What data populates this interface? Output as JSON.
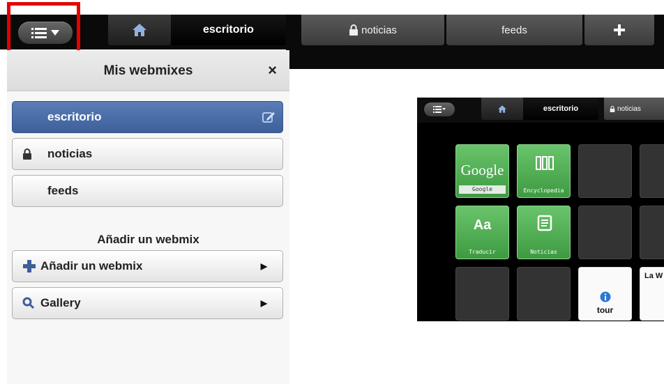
{
  "tabs": {
    "home_icon": "home-icon",
    "active": "escritorio",
    "noticias": "noticias",
    "feeds": "feeds",
    "add_icon": "plus-icon"
  },
  "menu": {
    "list_icon": "list-icon",
    "caret_icon": "caret-down-icon"
  },
  "panel": {
    "title": "Mis webmixes",
    "close": "×",
    "webmixes": [
      {
        "label": "escritorio",
        "active": true
      },
      {
        "label": "noticias",
        "icon": "lock-icon"
      },
      {
        "label": "feeds"
      }
    ],
    "section_title": "Añadir un webmix",
    "actions": [
      {
        "label": "Añadir un webmix",
        "icon": "plus-icon"
      },
      {
        "label": "Gallery",
        "icon": "search-icon"
      }
    ]
  },
  "thumbnail": {
    "tabs": {
      "active": "escritorio",
      "noticias": "noticias"
    },
    "tiles": [
      {
        "logo": "Google",
        "label": "Google"
      },
      {
        "label": "Encyclopedia"
      },
      {
        "logo": "Aa",
        "label": "Traducir"
      },
      {
        "label": "Noticias"
      },
      {
        "label": "tour"
      },
      {
        "label": "La W"
      }
    ]
  },
  "colors": {
    "accent": "#3d5f9a",
    "highlight": "#e60000",
    "tile_green": "#4caf50"
  }
}
